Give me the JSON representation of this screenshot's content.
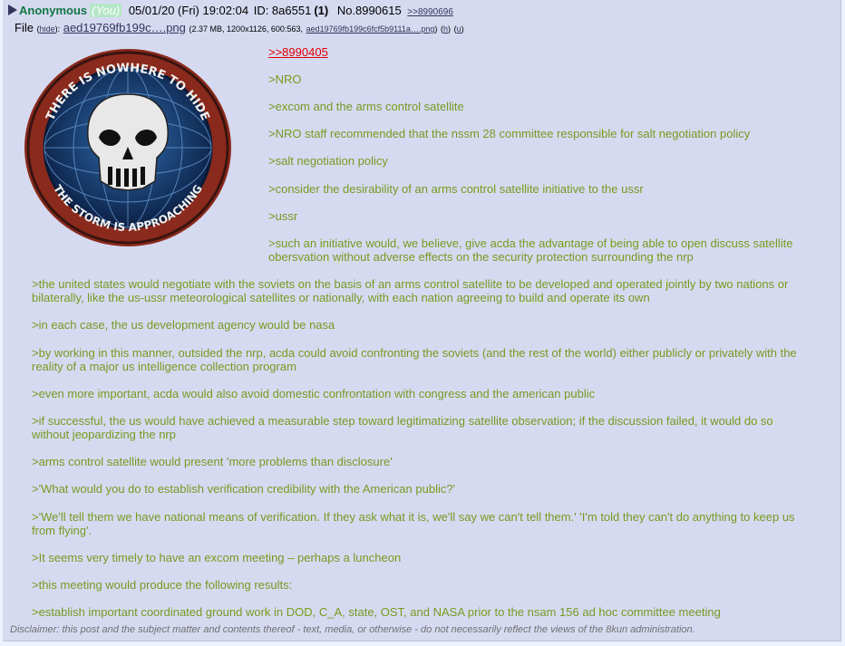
{
  "post": {
    "name": "Anonymous",
    "you": "(You)",
    "datetime": "05/01/20 (Fri) 19:02:04",
    "id_label": "ID: 8a6551",
    "id_count": "(1)",
    "number": "No.8990615",
    "backlink": ">>8990696"
  },
  "file": {
    "prefix": "File",
    "hide": "hide",
    "filename": "aed19769fb199c….png",
    "meta": "(2.37 MB, 1200x1126, 600:563,",
    "full_name": "aed19769fb199c6fcf5b9111a….png",
    "h": "h",
    "u": "u"
  },
  "thumbnail": {
    "top_text": "THERE IS NOWHERE TO HIDE",
    "bottom_text": "THE STORM IS APPROACHING"
  },
  "reply_link": ">>8990405",
  "short_lines": [
    ">NRO",
    ">excom and the arms control satellite",
    ">NRO staff recommended that the nssm 28 committee responsible for salt negotiation policy",
    ">salt negotiation policy",
    ">consider the desirability of an arms control satellite initiative to the ussr",
    ">ussr",
    ">such an initiative would, we believe, give acda the advantage of being able to open discuss satellite obersvation without adverse effects on the security protection surrounding the nrp"
  ],
  "long_lines": [
    ">the united states would negotiate with the soviets on the basis of an arms control satellite to be developed and operated jointly by two nations or bilaterally, like the us-ussr meteorological satellites or nationally, with each nation agreeing to build and operate its own",
    ">in each case, the us development agency would be nasa",
    ">by working in this manner, outsided the nrp, acda could avoid confronting the soviets (and the rest of the world) either publicly or privately with the reality of a major us intelligence collection program",
    ">even more important, acda would also avoid domestic confrontation with congress and the american public",
    ">if successful, the us would have achieved a measurable step toward legitimatizing satellite observation; if the discussion failed, it would do so without jeopardizing the nrp",
    ">arms control satellite would present 'more problems than disclosure'",
    ">'What would you do to establish verification credibility with the American public?'",
    ">'We'll tell them we have national means of verification. If they ask what it is, we'll say we can't tell them.' 'I'm told they can't do anything to keep us from flying'.",
    ">It seems very timely to have an excom meeting – perhaps a luncheon",
    ">this meeting would produce the following results:",
    ">establish important coordinated ground work in DOD, C_A, state, OST, and NASA prior to the nsam 156 ad hoc committee meeting"
  ],
  "disclaimer": "Disclaimer: this post and the subject matter and contents thereof - text, media, or otherwise - do not necessarily reflect the views of the 8kun administration.",
  "colors": {
    "greentext": "#789922",
    "name": "#117743",
    "post_bg": "#d6daf0",
    "page_bg": "#eef2ff"
  }
}
